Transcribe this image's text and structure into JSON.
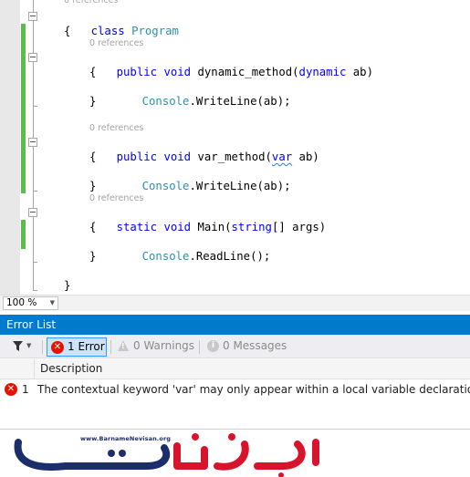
{
  "editor": {
    "codelens": "0 references",
    "lines": {
      "class_kw": "class",
      "class_name": "Program",
      "open_brace": "{",
      "close_brace": "}",
      "public_kw": "public",
      "void_kw": "void",
      "static_kw": "static",
      "dynamic_method_name": "dynamic_method(",
      "dynamic_kw": "dynamic",
      "param_ab": " ab)",
      "console_type": "Console",
      "writeline_call": ".WriteLine(ab);",
      "var_method_name": "var_method(",
      "var_kw": "var",
      "main_name": "Main(",
      "string_kw": "string",
      "args_param": "[] args)",
      "readline_call": ".ReadLine();"
    }
  },
  "zoom": {
    "value": "100 %"
  },
  "error_list": {
    "title": "Error List",
    "toolbar": {
      "errors_label": "1 Error",
      "warnings_label": "0 Warnings",
      "messages_label": "0 Messages"
    },
    "columns": {
      "description": "Description"
    },
    "rows": [
      {
        "number": "1",
        "description": "The contextual keyword 'var' may only appear within a local variable declaration"
      }
    ]
  },
  "logo": {
    "url_text": "www.BarnameNevisan.org"
  },
  "colors": {
    "accent": "#007acc",
    "keyword": "#0000ff",
    "type": "#2b91af",
    "error": "#e51400",
    "change_marker": "#57c04a",
    "logo_red": "#d7142b",
    "logo_navy": "#1b2d6b"
  }
}
